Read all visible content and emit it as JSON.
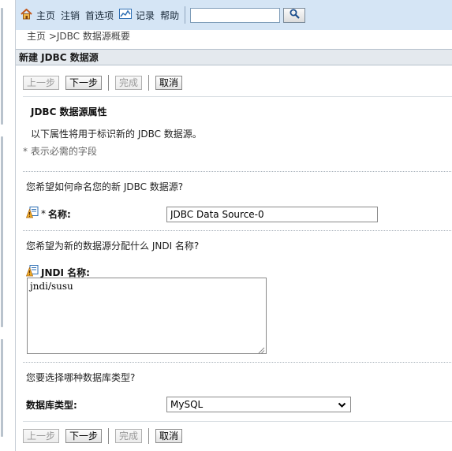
{
  "toolbar": {
    "home": "主页",
    "logout": "注销",
    "preferences": "首选项",
    "records": "记录",
    "help": "帮助",
    "search_value": ""
  },
  "breadcrumb": {
    "parent": "主页 >",
    "current": "JDBC 数据源概要"
  },
  "panel": {
    "title": "新建 JDBC 数据源"
  },
  "wizard_buttons": {
    "back": "上一步",
    "next": "下一步",
    "finish": "完成",
    "cancel": "取消"
  },
  "section": {
    "title": "JDBC 数据源属性",
    "description": "以下属性将用于标识新的 JDBC 数据源。",
    "required_note": "* 表示必需的字段"
  },
  "form": {
    "name_question": "您希望如何命名您的新 JDBC 数据源?",
    "name_required_mark": "*",
    "name_label": "名称:",
    "name_value": "JDBC Data Source-0",
    "jndi_question": "您希望为新的数据源分配什么 JNDI 名称?",
    "jndi_label": "JNDI 名称:",
    "jndi_value": "jndi/susu",
    "db_question": "您要选择哪种数据库类型?",
    "db_label": "数据库类型:",
    "db_selected": "MySQL"
  },
  "colors": {
    "toolbar_bg": "#d5e5f5",
    "panel_header_bg": "#e4e9ee"
  }
}
